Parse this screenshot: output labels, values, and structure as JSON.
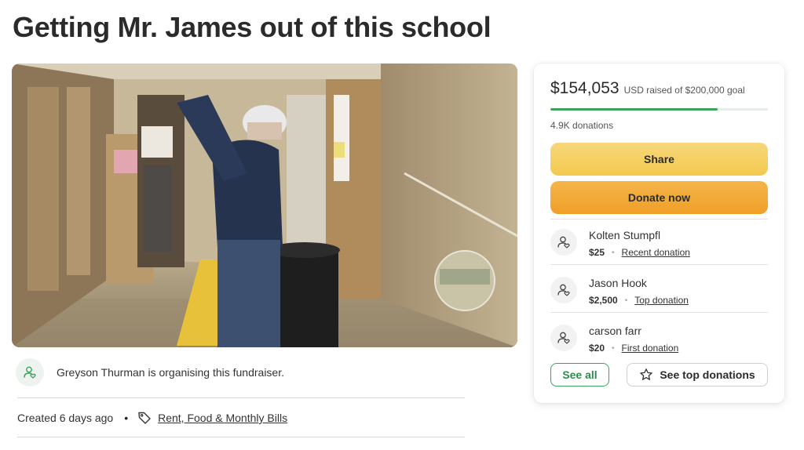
{
  "campaign": {
    "title": "Getting Mr. James out of this school"
  },
  "organiser": {
    "text": "Greyson Thurman is organising this fundraiser."
  },
  "meta": {
    "created": "Created 6 days ago",
    "separator": "•",
    "category": "Rent, Food & Monthly Bills"
  },
  "donation_card": {
    "amount_raised": "$154,053",
    "goal_text": "USD raised of $200,000 goal",
    "progress_fraction": 0.77,
    "donation_count": "4.9K donations",
    "share_label": "Share",
    "donate_label": "Donate now",
    "donors": [
      {
        "name": "Kolten Stumpfl",
        "amount": "$25",
        "kind": "Recent donation"
      },
      {
        "name": "Jason Hook",
        "amount": "$2,500",
        "kind": "Top donation"
      },
      {
        "name": "carson farr",
        "amount": "$20",
        "kind": "First donation"
      }
    ],
    "see_all_label": "See all",
    "see_top_label": "See top donations"
  },
  "icons": {
    "organiser_avatar": "user-heart-icon",
    "category": "tag-icon",
    "donor_avatar": "user-heart-icon",
    "see_top": "star-icon"
  },
  "colors": {
    "progress": "#3aa35b",
    "share_button": "#f3c94d",
    "donate_button": "#ef9f27",
    "see_all_border": "#3aa35b"
  }
}
